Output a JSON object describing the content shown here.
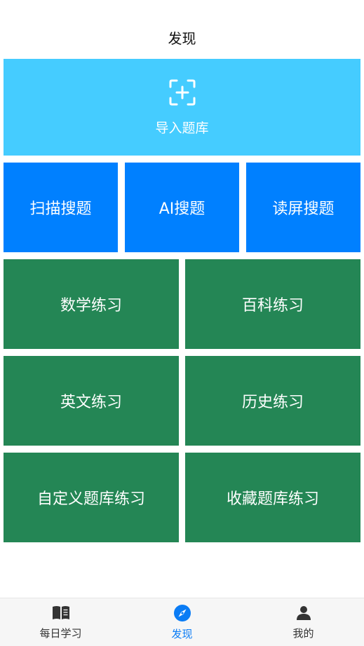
{
  "header": {
    "title": "发现"
  },
  "import_tile": {
    "label": "导入题库",
    "icon": "scan-plus-icon"
  },
  "search_tiles": [
    {
      "label": "扫描搜题"
    },
    {
      "label": "AI搜题"
    },
    {
      "label": "读屏搜题"
    }
  ],
  "practice_tiles": [
    {
      "label": "数学练习"
    },
    {
      "label": "百科练习"
    },
    {
      "label": "英文练习"
    },
    {
      "label": "历史练习"
    },
    {
      "label": "自定义题库练习"
    },
    {
      "label": "收藏题库练习"
    }
  ],
  "bottom_nav": {
    "items": [
      {
        "label": "每日学习",
        "icon": "book-icon",
        "active": false
      },
      {
        "label": "发现",
        "icon": "compass-icon",
        "active": true
      },
      {
        "label": "我的",
        "icon": "person-icon",
        "active": false
      }
    ]
  },
  "colors": {
    "import": "#45ccff",
    "search": "#0080ff",
    "practice": "#248655",
    "active_nav": "#0a7cf5"
  }
}
